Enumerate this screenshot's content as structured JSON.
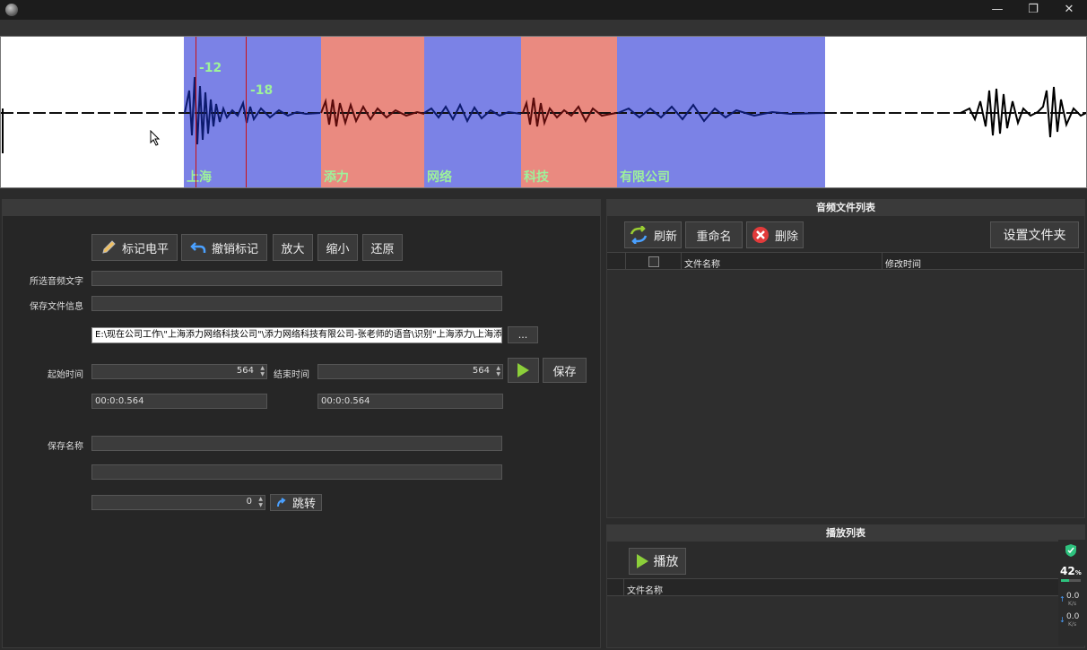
{
  "window": {
    "minimize": "—",
    "maximize": "❐",
    "close": "✕"
  },
  "waveform": {
    "segments": [
      {
        "label": "上海",
        "color": "blue"
      },
      {
        "label": "添力",
        "color": "red"
      },
      {
        "label": "网络",
        "color": "blue"
      },
      {
        "label": "科技",
        "color": "red"
      },
      {
        "label": "有限公司",
        "color": "blue"
      }
    ],
    "markers": [
      {
        "label": "-12"
      },
      {
        "label": "-18"
      }
    ]
  },
  "editor": {
    "toolbar": {
      "mark_level": "标记电平",
      "undo_mark": "撤销标记",
      "zoom_in": "放大",
      "zoom_out": "缩小",
      "restore": "还原"
    },
    "selected_audio_text_label": "所选音频文字",
    "selected_audio_text_value": "",
    "save_file_info_label": "保存文件信息",
    "save_file_info_value": "",
    "path_value": "E:\\现在公司工作\\\"上海添力网络科技公司\"\\添力网络科技有限公司-张老师的语音\\识别\"上海添力\\上海添",
    "browse": "...",
    "start_time_label": "起始时间",
    "start_time_value": "564",
    "end_time_label": "结束时间",
    "end_time_value": "564",
    "save": "保存",
    "start_time_display": "00:0:0.564",
    "end_time_display": "00:0:0.564",
    "save_name_label": "保存名称",
    "save_name_value": "",
    "extra_field_value": "",
    "jump_value": "0",
    "jump": "跳转"
  },
  "file_list": {
    "title": "音频文件列表",
    "refresh": "刷新",
    "rename": "重命名",
    "delete": "删除",
    "set_folder": "设置文件夹",
    "columns": [
      "文件名称",
      "修改时间"
    ]
  },
  "playlist": {
    "title": "播放列表",
    "play": "播放",
    "columns": [
      "文件名称"
    ]
  },
  "system_widget": {
    "percent": "42",
    "percent_unit": "%",
    "up": "0.0",
    "up_unit": "K/s",
    "down": "0.0",
    "down_unit": "K/s"
  },
  "colors": {
    "segment_blue": "#7b82e6",
    "segment_red": "#ea8a80",
    "label_green": "#9ef29a",
    "play_green": "#8ccf3a"
  }
}
